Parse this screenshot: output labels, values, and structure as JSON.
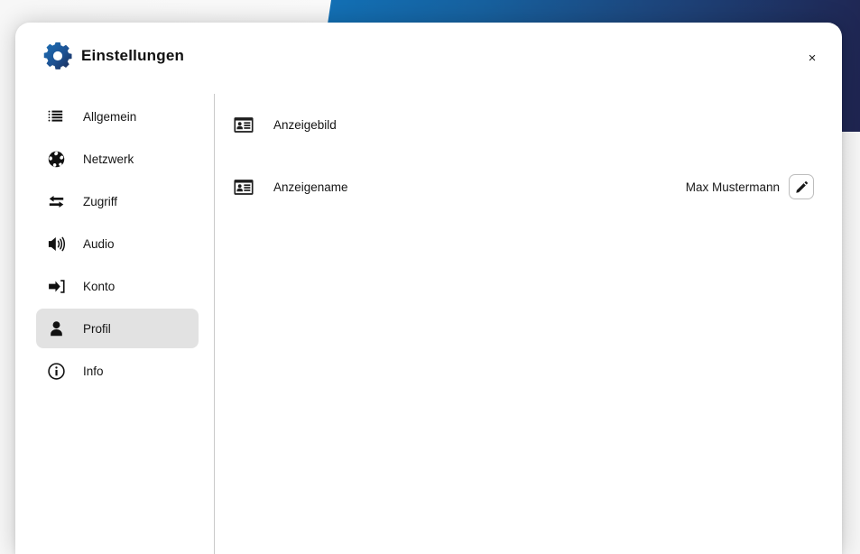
{
  "window": {
    "title": "Einstellungen",
    "app_icon": "gear-icon",
    "close_label": "×"
  },
  "theme": {
    "accent_blue": "#1272b8",
    "accent_navy": "#1f2450",
    "selected_bg": "#e2e2e2",
    "divider": "#c9c9c9",
    "text": "#141414"
  },
  "sidebar": {
    "items": [
      {
        "id": "allgemein",
        "label": "Allgemein",
        "icon": "list-icon",
        "selected": false
      },
      {
        "id": "netzwerk",
        "label": "Netzwerk",
        "icon": "globe-icon",
        "selected": false
      },
      {
        "id": "zugriff",
        "label": "Zugriff",
        "icon": "transfer-arrows-icon",
        "selected": false
      },
      {
        "id": "audio",
        "label": "Audio",
        "icon": "speaker-icon",
        "selected": false
      },
      {
        "id": "konto",
        "label": "Konto",
        "icon": "login-icon",
        "selected": false
      },
      {
        "id": "profil",
        "label": "Profil",
        "icon": "person-icon",
        "selected": true
      },
      {
        "id": "info",
        "label": "Info",
        "icon": "info-circle-icon",
        "selected": false
      }
    ]
  },
  "content": {
    "rows": [
      {
        "id": "anzeigebild",
        "label": "Anzeigebild",
        "icon": "id-card-icon",
        "value": "",
        "has_edit_button": false
      },
      {
        "id": "anzeigename",
        "label": "Anzeigename",
        "icon": "id-card-icon",
        "value": "Max Mustermann",
        "has_edit_button": true,
        "edit_icon": "pencil-icon"
      }
    ]
  }
}
